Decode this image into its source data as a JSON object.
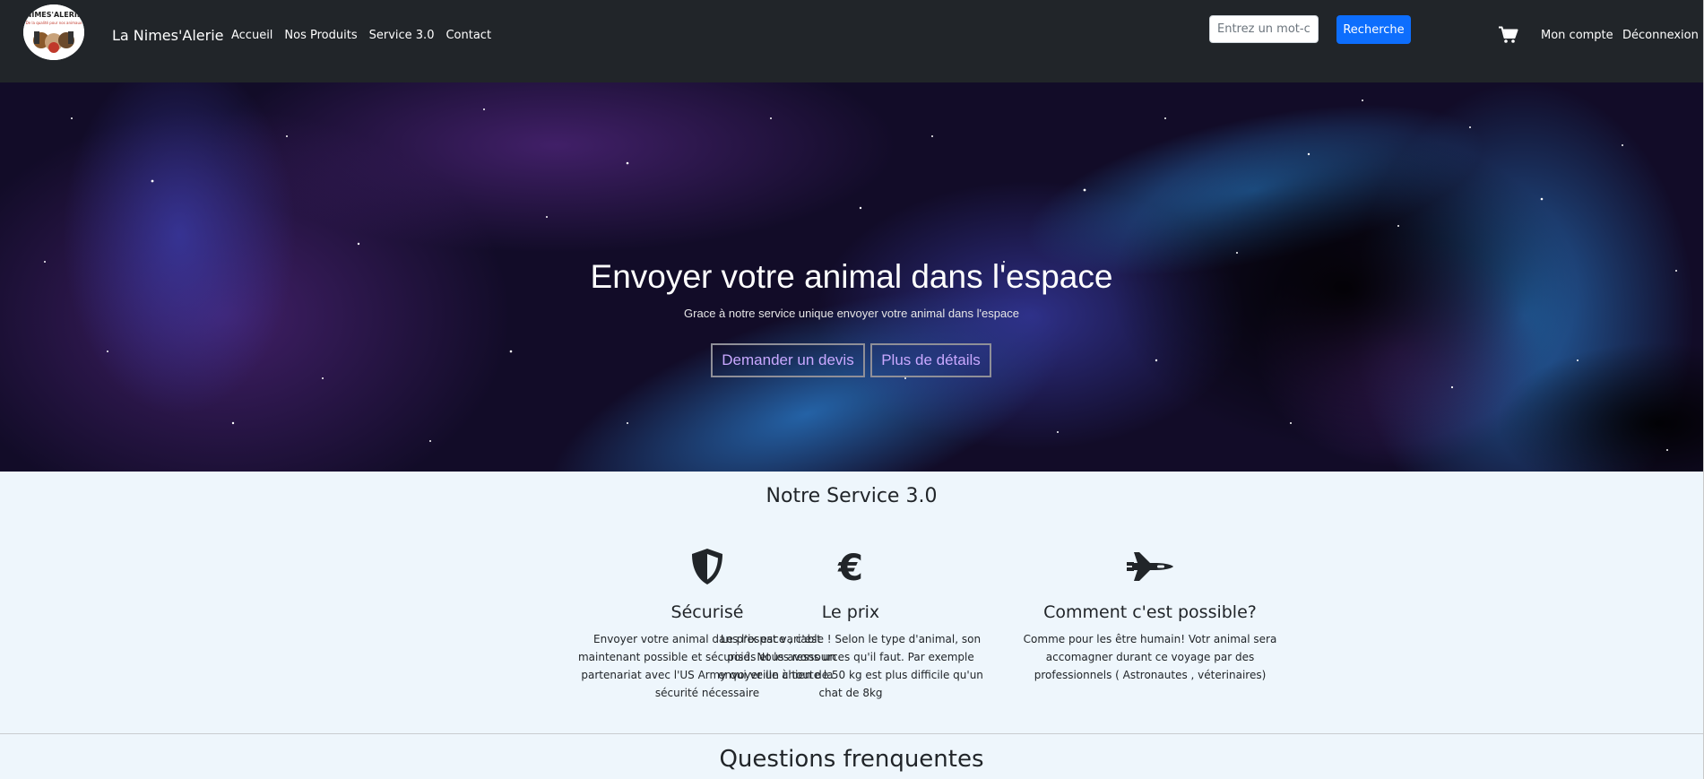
{
  "navbar": {
    "logo_alt": "NIMES'ALERIE logo",
    "brand": "La Nimes'Alerie",
    "links": [
      "Accueil",
      "Nos Produits",
      "Service 3.0",
      "Contact"
    ],
    "search": {
      "placeholder": "Entrez un mot-clé",
      "value": ""
    },
    "search_button": "Recherche",
    "cart_icon": "shopping-cart-icon",
    "account": "Mon compte",
    "logout": "Déconnexion"
  },
  "hero": {
    "title": "Envoyer votre animal dans l'espace",
    "subtitle": "Grace à notre service unique envoyer votre animal dans l'espace",
    "button_quote": "Demander un devis",
    "button_details": "Plus de détails",
    "background": "space-nebula-image"
  },
  "service": {
    "title": "Notre Service 3.0",
    "features": [
      {
        "icon": "shield-icon",
        "title": "Sécurisé",
        "text": "Envoyer votre animal dans l'espace , c'est maintenant possible et sécurisé. Nous avons un partenariat avec l'US Army qui veille à toute la sécurité nécessaire"
      },
      {
        "icon": "euro-icon",
        "title": "Le prix",
        "text": "Le prix est variable ! Selon le type d'animal, son poids et les ressources qu'il faut. Par exemple envoyer un chien de 50 kg est plus difficile qu'un chat de 8kg"
      },
      {
        "icon": "space-shuttle-icon",
        "title": "Comment c'est possible?",
        "text": "Comme pour les être humain! Votr animal sera accomagner durant ce voyage par des professionnels ( Astronautes , véterinaires)"
      }
    ]
  },
  "faq": {
    "title": "Questions frenquentes"
  },
  "colors": {
    "navbar_bg": "#212529",
    "primary": "#0d6efd",
    "hero_button_text": "#c9a8ff",
    "section_bg": "#eef6fc"
  }
}
